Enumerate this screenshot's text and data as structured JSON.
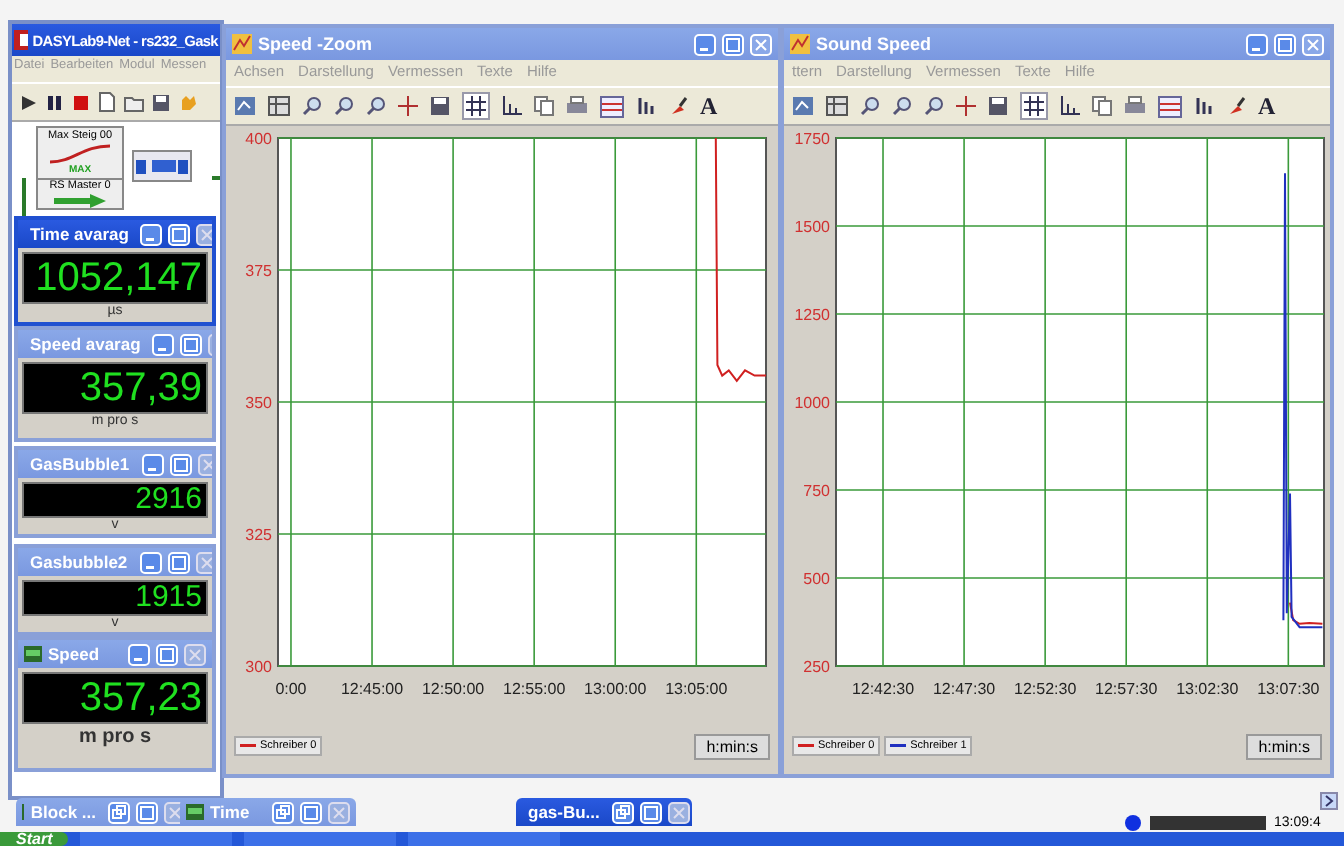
{
  "main_window": {
    "title": "DASYLab9-Net - rs232_Gask",
    "menu": [
      "Datei",
      "Bearbeiten",
      "Modul",
      "Messen"
    ],
    "blocks": [
      {
        "label": "Max Steig 00",
        "badge": "MAX"
      },
      {
        "label": "RS Master 0"
      }
    ]
  },
  "chart_windows": [
    {
      "title": "Speed -Zoom",
      "clipped_tick_label": "0:00",
      "menu": [
        "Achsen",
        "Darstellung",
        "Vermessen",
        "Texte",
        "Hilfe"
      ],
      "font_button": "A",
      "units": "h:min:s",
      "chart_data": {
        "type": "line",
        "xlim": [
          45552,
          47358
        ],
        "ylim": [
          300,
          400
        ],
        "yticks": [
          300,
          325,
          350,
          375,
          400
        ],
        "grid": true,
        "xticks": [
          {
            "value": 45900,
            "label": "12:45:00"
          },
          {
            "value": 46200,
            "label": "12:50:00"
          },
          {
            "value": 46500,
            "label": "12:55:00"
          },
          {
            "value": 46800,
            "label": "13:00:00"
          },
          {
            "value": 47100,
            "label": "13:05:00"
          }
        ],
        "series": [
          {
            "name": "Schreiber 0",
            "color": "#d02020",
            "values": [
              400,
              357,
              355,
              356,
              354,
              356,
              355,
              355
            ],
            "x": [
              47172,
              47178,
              47196,
              47220,
              47250,
              47280,
              47316,
              47358
            ]
          }
        ]
      }
    },
    {
      "title": "Sound Speed",
      "menu": [
        "ttern",
        "Darstellung",
        "Vermessen",
        "Texte",
        "Hilfe"
      ],
      "font_button": "A",
      "units": "h:min:s",
      "chart_data": {
        "type": "line",
        "xlim": [
          45576,
          47382
        ],
        "ylim": [
          250,
          1750
        ],
        "grid": true,
        "yticks": [
          250,
          500,
          750,
          1000,
          1250,
          1500,
          1750
        ],
        "xticks": [
          {
            "value": 45750,
            "label": "12:42:30"
          },
          {
            "value": 46050,
            "label": "12:47:30"
          },
          {
            "value": 46350,
            "label": "12:52:30"
          },
          {
            "value": 46650,
            "label": "12:57:30"
          },
          {
            "value": 46950,
            "label": "13:02:30"
          },
          {
            "value": 47250,
            "label": "13:07:30"
          }
        ],
        "series": [
          {
            "name": "Schreiber 0",
            "color": "#d02020",
            "values": [
              430,
              380,
              370,
              372,
              370
            ],
            "x": [
              47256,
              47268,
              47292,
              47328,
              47376
            ]
          },
          {
            "name": "Schreiber 1",
            "color": "#2030c0",
            "values": [
              380,
              1650,
              400,
              740,
              390,
              360,
              360
            ],
            "x": [
              47232,
              47238,
              47244,
              47256,
              47262,
              47292,
              47376
            ]
          }
        ]
      }
    }
  ],
  "meters": [
    {
      "title": "Time avarag",
      "value": "1052,147",
      "unit": "µs",
      "kind": "large",
      "active": true
    },
    {
      "title": "Speed avarag",
      "value": "357,39",
      "unit": "m pro s",
      "kind": "large",
      "active": false
    },
    {
      "title": "GasBubble1",
      "value": "2916",
      "unit": "v",
      "kind": "small",
      "active": false
    },
    {
      "title": "Gasbubble2",
      "value": "1915",
      "unit": "v",
      "kind": "small",
      "active": false
    },
    {
      "title": "Speed",
      "value": "357,23",
      "unit": "m pro s",
      "kind": "large",
      "active": false
    }
  ],
  "minimized": [
    {
      "title": "Block ...",
      "active": false
    },
    {
      "title": "Time",
      "active": false
    },
    {
      "title": "gas-Bu...",
      "active": true
    }
  ],
  "status": {
    "level": 1,
    "time": "13:09:4"
  },
  "taskbar": {
    "start": "Start"
  }
}
